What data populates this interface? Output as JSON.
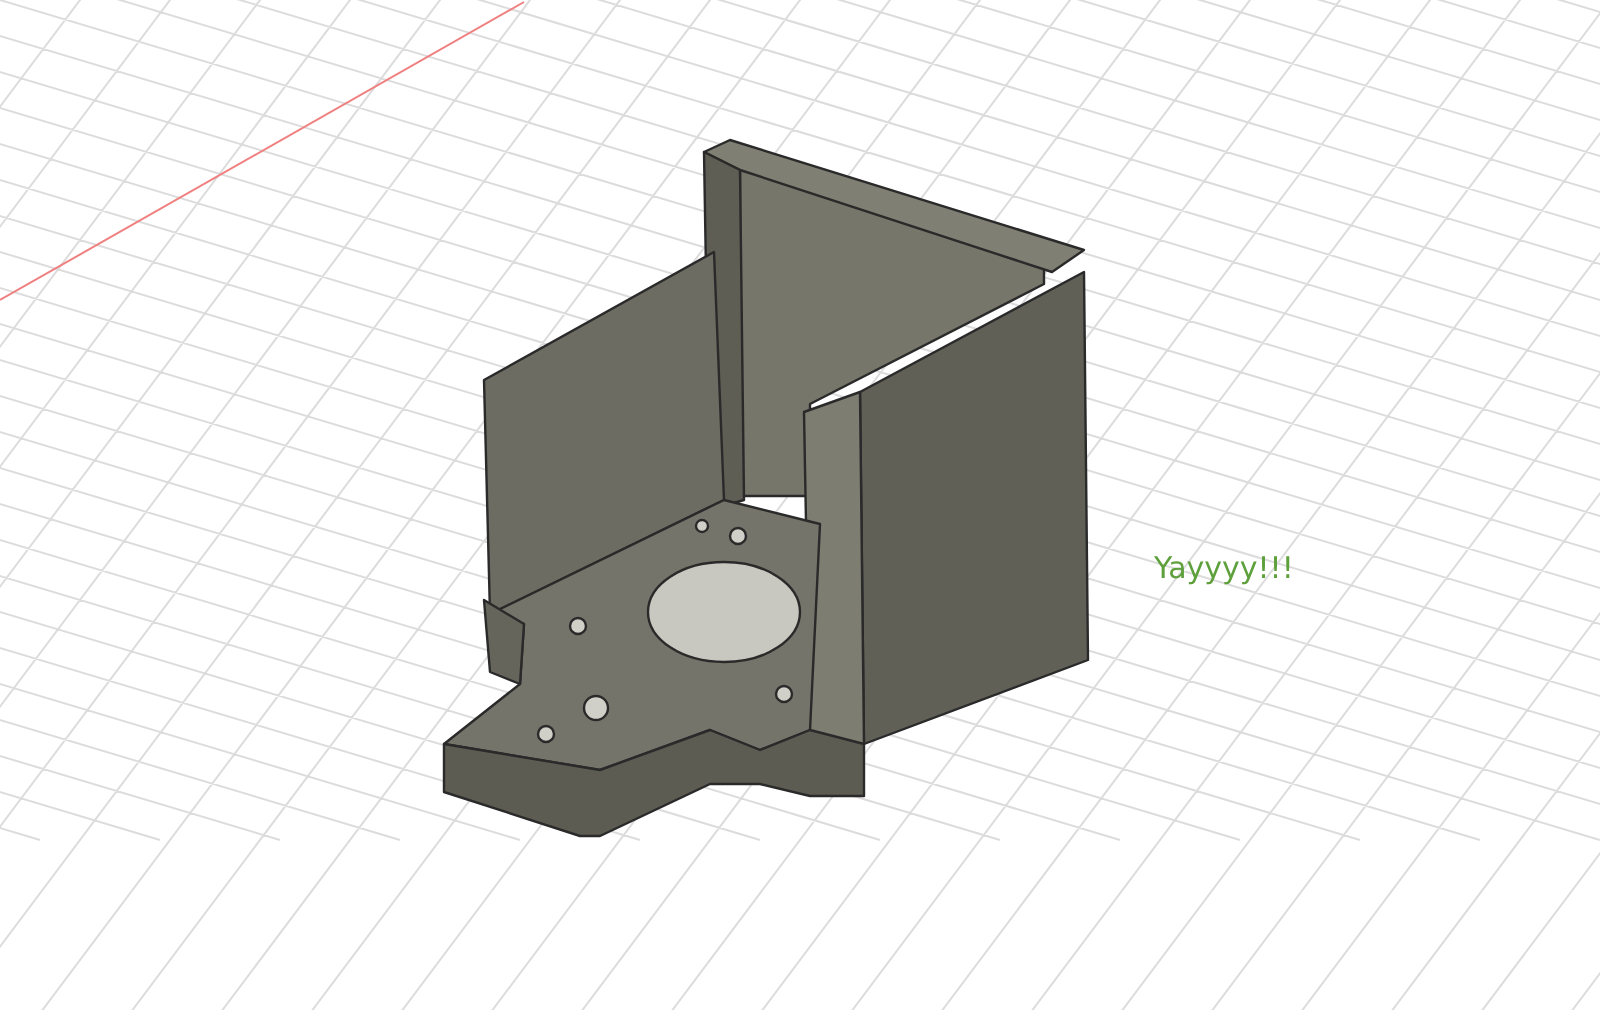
{
  "annotation": {
    "text": "Yayyyy!!!"
  }
}
